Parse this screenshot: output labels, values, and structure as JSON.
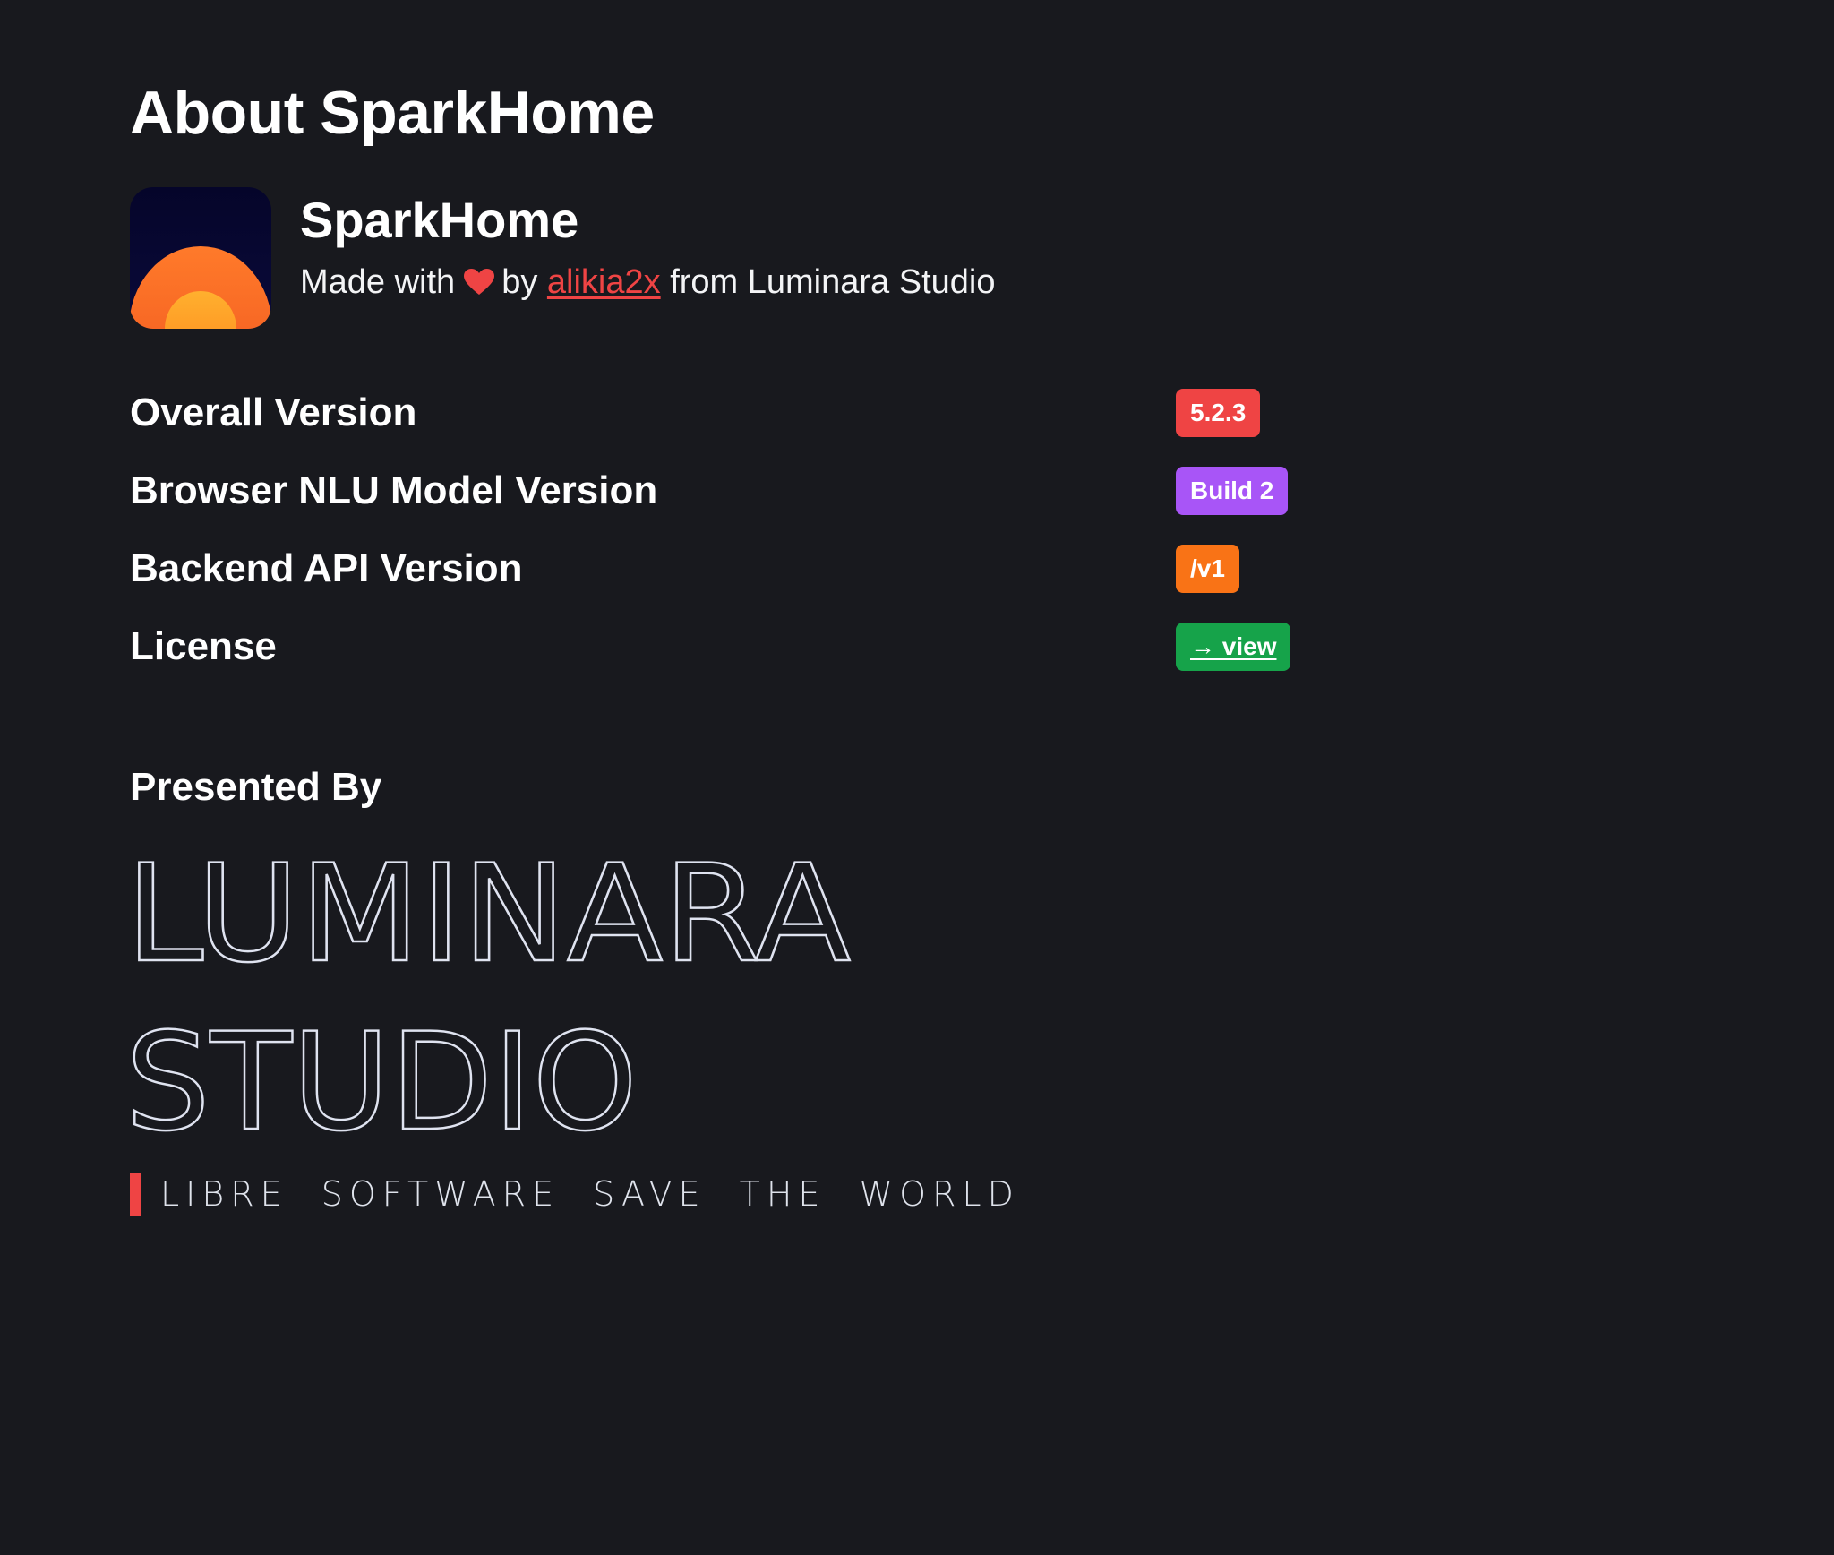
{
  "page": {
    "title": "About SparkHome"
  },
  "app": {
    "name": "SparkHome",
    "icon": "sunrise-app-icon",
    "credit": {
      "prefix": "Made with",
      "heart_icon": "heart-icon",
      "middle": "by",
      "author": "alikia2x",
      "suffix": "from Luminara Studio"
    }
  },
  "versions": [
    {
      "label": "Overall Version",
      "value": "5.2.3",
      "color": "#ef4444"
    },
    {
      "label": "Browser NLU Model Version",
      "value": "Build 2",
      "color": "#a855f7"
    },
    {
      "label": "Backend API Version",
      "value": "/v1",
      "color": "#f97316"
    },
    {
      "label": "License",
      "value": "→ view",
      "color": "#16a34a"
    }
  ],
  "presented_by": {
    "heading": "Presented By",
    "logo_line1": "LUMINARA",
    "logo_line2": "STUDIO",
    "slogan": "LIBRE SOFTWARE SAVE THE WORLD",
    "accent": "#ef4444"
  },
  "colors": {
    "background": "#18191e",
    "text": "#ffffff",
    "link": "#ef4444",
    "logo_stroke": "#dfe3f0"
  }
}
